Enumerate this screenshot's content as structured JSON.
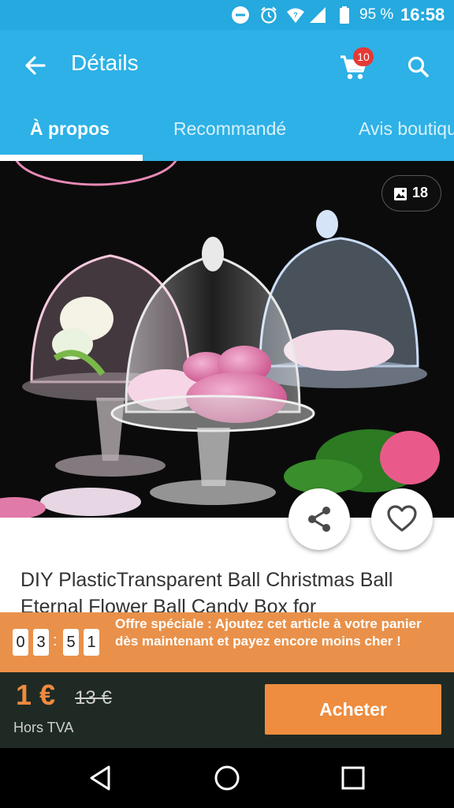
{
  "status_bar": {
    "battery_pct": "95 %",
    "time": "16:58",
    "icons": [
      "do-not-disturb-icon",
      "alarm-icon",
      "wifi-icon",
      "signal-icon",
      "battery-icon"
    ]
  },
  "app_bar": {
    "title": "Détails",
    "cart_badge": "10",
    "icons": [
      "back-arrow-icon",
      "cart-icon",
      "search-icon"
    ]
  },
  "tabs": [
    {
      "label": "À propos",
      "active": true
    },
    {
      "label": "Recommandé",
      "active": false
    },
    {
      "label": "Avis boutique",
      "active": false
    }
  ],
  "gallery": {
    "photo_count": "18"
  },
  "product": {
    "title": "DIY PlasticTransparent Ball Christmas Ball Eternal Flower Ball Candy Box for"
  },
  "offer": {
    "countdown_digits": [
      "0",
      "3",
      "5",
      "1"
    ],
    "separator": ":",
    "text": "Offre spéciale : Ajoutez cet article à votre panier dès maintenant et payez encore moins cher !"
  },
  "price": {
    "current": "1 €",
    "original": "13 €",
    "tax_note": "Hors TVA"
  },
  "buy": {
    "label": "Acheter"
  },
  "colors": {
    "primary": "#2db1e6",
    "status_bar": "#25a9de",
    "accent_orange": "#ee8c3f",
    "price_bar_bg": "#1f2a24",
    "badge_red": "#e53935"
  }
}
